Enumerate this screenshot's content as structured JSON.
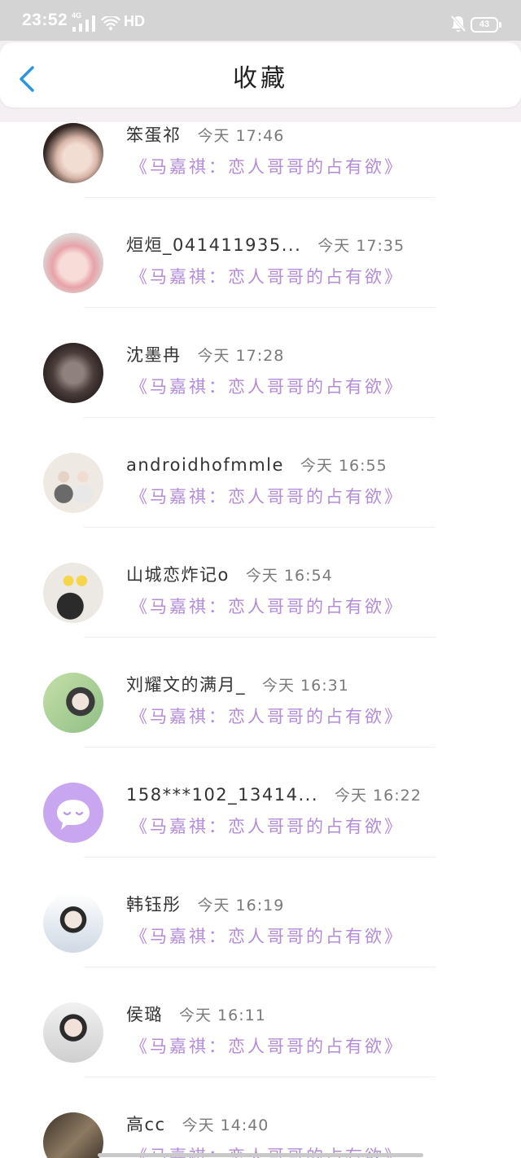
{
  "status_bar": {
    "time": "23:52",
    "network": "4G",
    "hd": "HD",
    "battery": "43",
    "icons": [
      "signal-icon",
      "wifi-icon",
      "mute-bell-icon",
      "battery-icon"
    ]
  },
  "header": {
    "title": "收藏",
    "back_icon": "chevron-left-icon"
  },
  "colors": {
    "accent": "#2b95e0",
    "story_title": "#b48bd8",
    "default_avatar": "#c9a7f0",
    "status_bar": "#d4d4d4"
  },
  "items": [
    {
      "name": "笨蛋祁",
      "time": "今天 17:46",
      "title": "《马嘉祺：恋人哥哥的占有欲》"
    },
    {
      "name": "烜烜_041411935...",
      "time": "今天 17:35",
      "title": "《马嘉祺：恋人哥哥的占有欲》"
    },
    {
      "name": "沈墨冉",
      "time": "今天 17:28",
      "title": "《马嘉祺：恋人哥哥的占有欲》"
    },
    {
      "name": "androidhofmmle",
      "time": "今天 16:55",
      "title": "《马嘉祺：恋人哥哥的占有欲》"
    },
    {
      "name": "山城恋炸记o",
      "time": "今天 16:54",
      "title": "《马嘉祺：恋人哥哥的占有欲》"
    },
    {
      "name": "刘耀文的满月_",
      "time": "今天 16:31",
      "title": "《马嘉祺：恋人哥哥的占有欲》"
    },
    {
      "name": "158***102_13414...",
      "time": "今天 16:22",
      "title": "《马嘉祺：恋人哥哥的占有欲》",
      "avatar_icon": "default-avatar-icon"
    },
    {
      "name": "韩钰彤",
      "time": "今天 16:19",
      "title": "《马嘉祺：恋人哥哥的占有欲》"
    },
    {
      "name": "侯璐",
      "time": "今天 16:11",
      "title": "《马嘉祺：恋人哥哥的占有欲》"
    },
    {
      "name": "高cc",
      "time": "今天 14:40",
      "title": "《马嘉祺：恋人哥哥的占有欲》"
    }
  ]
}
